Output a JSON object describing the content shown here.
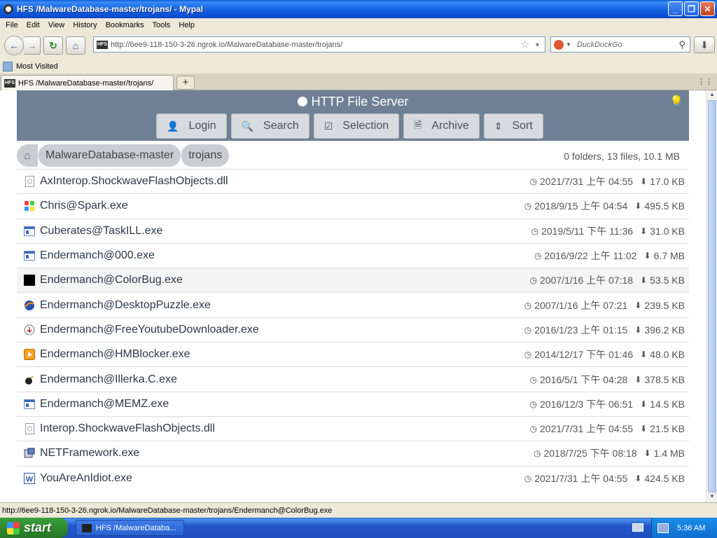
{
  "window": {
    "title": "HFS /MalwareDatabase-master/trojans/ - Mypal",
    "minimize": "_",
    "maximize": "❐",
    "close": "✕"
  },
  "menu": [
    "File",
    "Edit",
    "View",
    "History",
    "Bookmarks",
    "Tools",
    "Help"
  ],
  "nav": {
    "url": "http://6ee9-118-150-3-26.ngrok.io/MalwareDatabase-master/trojans/",
    "search_placeholder": "DuckDuckGo",
    "site_icon": "HFS"
  },
  "bookmarks": {
    "most_visited": "Most Visited"
  },
  "tab": {
    "label": "HFS /MalwareDatabase-master/trojans/",
    "icon": "HFS",
    "new_tab": "+"
  },
  "hfs": {
    "title": "HTTP File Server",
    "buttons": [
      {
        "label": "Login",
        "icon": "user-icon"
      },
      {
        "label": "Search",
        "icon": "search-icon"
      },
      {
        "label": "Selection",
        "icon": "checkbox-icon"
      },
      {
        "label": "Archive",
        "icon": "archive-icon"
      },
      {
        "label": "Sort",
        "icon": "sort-icon"
      }
    ],
    "crumbs": [
      "MalwareDatabase-master",
      "trojans"
    ],
    "summary": "0 folders, 13 files, 10.1 MB"
  },
  "files": [
    {
      "name": "AxInterop.ShockwaveFlashObjects.dll",
      "date": "2021/7/31 上午 04:55",
      "size": "17.0 KB",
      "icon": "dll-file-icon"
    },
    {
      "name": "Chris@Spark.exe",
      "date": "2018/9/15 上午 04:54",
      "size": "495.5 KB",
      "icon": "windows-flag-icon"
    },
    {
      "name": "Cuberates@TaskILL.exe",
      "date": "2019/5/11 下午 11:36",
      "size": "31.0 KB",
      "icon": "exe-window-icon"
    },
    {
      "name": "Endermanch@000.exe",
      "date": "2016/9/22 上午 11:02",
      "size": "6.7 MB",
      "icon": "exe-window-icon"
    },
    {
      "name": "Endermanch@ColorBug.exe",
      "date": "2007/1/16 上午 07:18",
      "size": "53.5 KB",
      "icon": "black-square-icon"
    },
    {
      "name": "Endermanch@DesktopPuzzle.exe",
      "date": "2007/1/16 上午 07:21",
      "size": "239.5 KB",
      "icon": "puzzle-globe-icon"
    },
    {
      "name": "Endermanch@FreeYoutubeDownloader.exe",
      "date": "2016/1/23 上午 01:15",
      "size": "396.2 KB",
      "icon": "download-circle-icon"
    },
    {
      "name": "Endermanch@HMBlocker.exe",
      "date": "2014/12/17 下午 01:46",
      "size": "48.0 KB",
      "icon": "play-box-icon"
    },
    {
      "name": "Endermanch@Illerka.C.exe",
      "date": "2016/5/1 下午 04:28",
      "size": "378.5 KB",
      "icon": "bomb-icon"
    },
    {
      "name": "Endermanch@MEMZ.exe",
      "date": "2016/12/3 下午 06:51",
      "size": "14.5 KB",
      "icon": "exe-window-icon"
    },
    {
      "name": "Interop.ShockwaveFlashObjects.dll",
      "date": "2021/7/31 上午 04:55",
      "size": "21.5 KB",
      "icon": "dll-file-icon"
    },
    {
      "name": "NETFramework.exe",
      "date": "2018/7/25 下午 08:18",
      "size": "1.4 MB",
      "icon": "installer-icon"
    },
    {
      "name": "YouAreAnIdiot.exe",
      "date": "2021/7/31 上午 04:55",
      "size": "424.5 KB",
      "icon": "word-doc-icon"
    }
  ],
  "status": "http://6ee9-118-150-3-26.ngrok.io/MalwareDatabase-master/trojans/Endermanch@ColorBug.exe",
  "taskbar": {
    "start": "start",
    "item": "HFS /MalwareDataba...",
    "clock": "5:36 AM"
  }
}
